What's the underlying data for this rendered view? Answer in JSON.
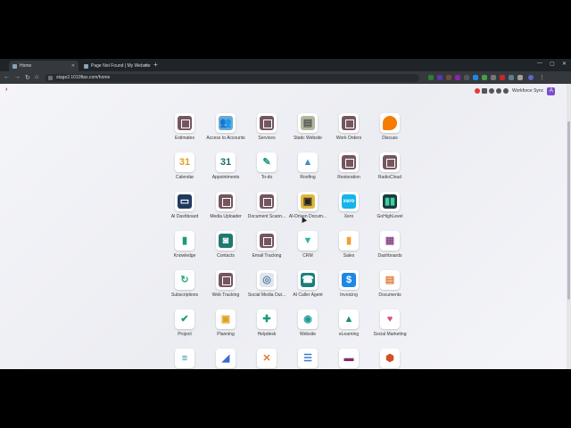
{
  "browser": {
    "tabs": [
      {
        "label": "Home",
        "active": true
      },
      {
        "label": "Page Not Found | My Website",
        "active": false
      }
    ],
    "url": "stage2.1010ftax.com/home"
  },
  "header": {
    "company": "Workforce Sync",
    "user_initial": "A"
  },
  "apps": [
    {
      "label": "Estimates",
      "icon": "cube-icon"
    },
    {
      "label": "Access to Accounts",
      "icon": "users-icon"
    },
    {
      "label": "Services",
      "icon": "cube-icon"
    },
    {
      "label": "Static Website",
      "icon": "website-icon"
    },
    {
      "label": "Work Orders",
      "icon": "cube-icon"
    },
    {
      "label": "Discuss",
      "icon": "chat-icon"
    },
    {
      "label": "Calendar",
      "icon": "calendar-icon",
      "glyph": "31"
    },
    {
      "label": "Appointments",
      "icon": "appointment-icon",
      "glyph": "31"
    },
    {
      "label": "To-do",
      "icon": "pen-icon"
    },
    {
      "label": "Roofing",
      "icon": "house-icon"
    },
    {
      "label": "Restoration",
      "icon": "cube-icon"
    },
    {
      "label": "RadioCloud",
      "icon": "cube-icon"
    },
    {
      "label": "AI Dashboard",
      "icon": "dashboard-icon"
    },
    {
      "label": "Media Uploader",
      "icon": "cube-icon"
    },
    {
      "label": "Document Scann...",
      "icon": "cube-icon"
    },
    {
      "label": "AI-Driven Docum...",
      "icon": "document-ai-icon"
    },
    {
      "label": "Xero",
      "icon": "xero-icon",
      "glyph": "xero"
    },
    {
      "label": "GoHighLevel",
      "icon": "bars-icon"
    },
    {
      "label": "Knowledge",
      "icon": "book-icon"
    },
    {
      "label": "Contacts",
      "icon": "contact-icon"
    },
    {
      "label": "Email Tracking",
      "icon": "cube-icon"
    },
    {
      "label": "CRM",
      "icon": "crm-icon"
    },
    {
      "label": "Sales",
      "icon": "sales-chart-icon"
    },
    {
      "label": "Dashboards",
      "icon": "grid-icon"
    },
    {
      "label": "Subscriptions",
      "icon": "refresh-icon"
    },
    {
      "label": "Web Tracking",
      "icon": "cube-icon"
    },
    {
      "label": "Social Media Out...",
      "icon": "globe-icon"
    },
    {
      "label": "AI Caller Agent",
      "icon": "caller-icon"
    },
    {
      "label": "Invoicing",
      "icon": "invoice-icon",
      "glyph": "$"
    },
    {
      "label": "Documents",
      "icon": "documents-icon"
    },
    {
      "label": "Project",
      "icon": "check-icon"
    },
    {
      "label": "Planning",
      "icon": "planning-icon"
    },
    {
      "label": "Helpdesk",
      "icon": "helpdesk-icon"
    },
    {
      "label": "Website",
      "icon": "website-globe-icon"
    },
    {
      "label": "eLearning",
      "icon": "graduation-icon"
    },
    {
      "label": "Social Marketing",
      "icon": "heart-icon"
    },
    {
      "label": "",
      "icon": "stripes-icon"
    },
    {
      "label": "",
      "icon": "paper-plane-icon"
    },
    {
      "label": "",
      "icon": "tools-icon"
    },
    {
      "label": "",
      "icon": "list-icon"
    },
    {
      "label": "",
      "icon": "layers-icon"
    },
    {
      "label": "",
      "icon": "shield-icon"
    }
  ]
}
